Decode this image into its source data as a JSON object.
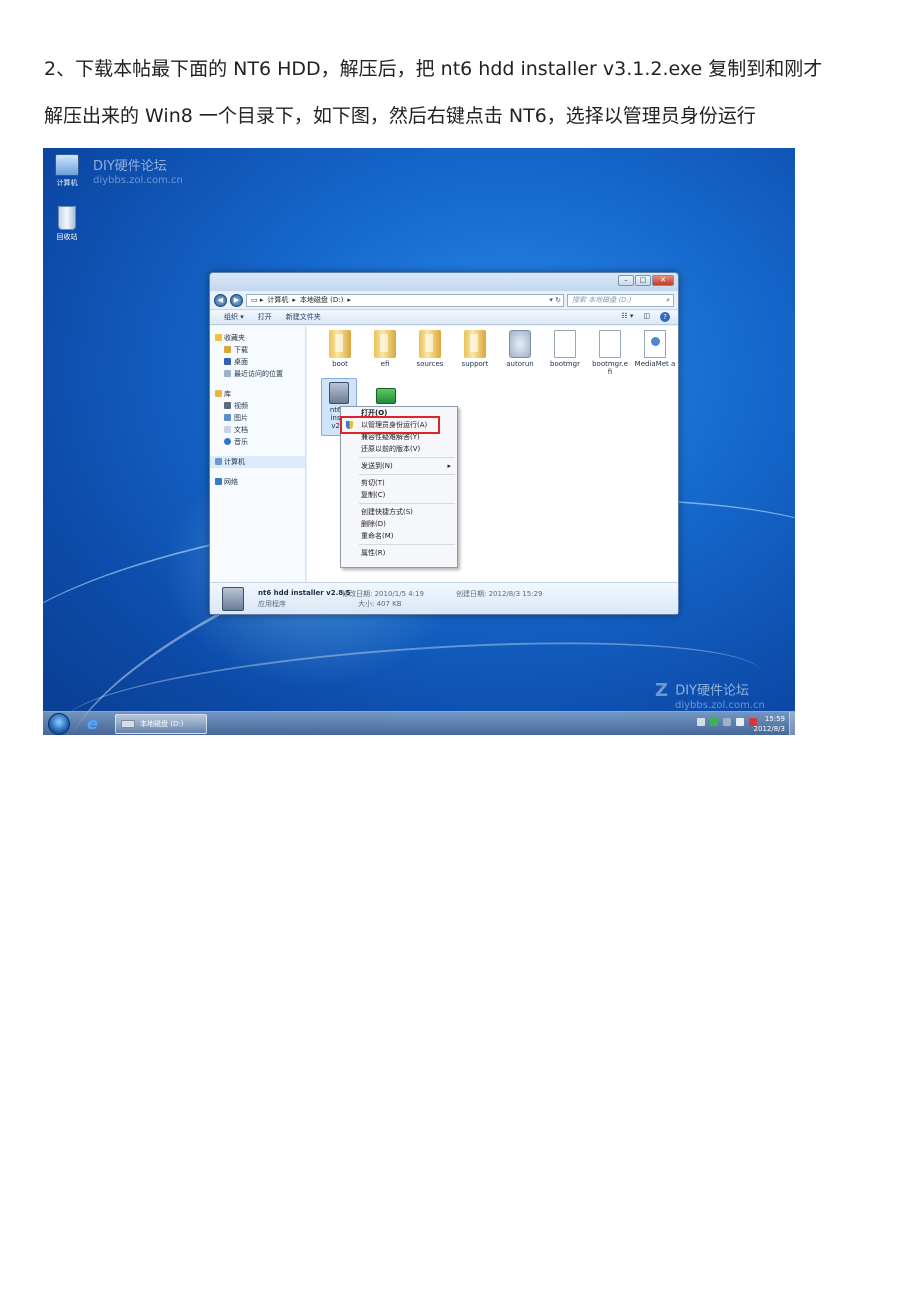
{
  "article": {
    "line1": "2、下载本帖最下面的 NT6 HDD，解压后，把 nt6 hdd installer v3.1.2.exe 复制到和刚才",
    "line2": "解压出来的 Win8 一个目录下，如下图，然后右键点击 NT6，选择以管理员身份运行"
  },
  "screenshot": {
    "desktop": {
      "icons": [
        "计算机",
        "回收站"
      ],
      "watermark_top": {
        "title": "DIY硬件论坛",
        "url": "diybbs.zol.com.cn"
      },
      "watermark_bottom": {
        "title": "DIY硬件论坛",
        "url": "diybbs.zol.com.cn"
      }
    },
    "explorer": {
      "breadcrumb": [
        "计算机",
        "本地磁盘 (D:)"
      ],
      "search_placeholder": "搜索 本地磁盘 (D:)",
      "toolbar": {
        "organize": "组织 ▾",
        "open": "打开",
        "new_folder": "新建文件夹"
      },
      "nav": {
        "favorites": "收藏夹",
        "downloads": "下载",
        "desktop": "桌面",
        "recent": "最近访问的位置",
        "libraries": "库",
        "videos": "视频",
        "pictures": "图片",
        "documents": "文档",
        "music": "音乐",
        "computer": "计算机",
        "network": "网络"
      },
      "files": [
        "boot",
        "efi",
        "sources",
        "support",
        "autorun",
        "bootmgr",
        "bootmgr.e fi",
        "MediaMet a"
      ],
      "selected_file_fragment": [
        "nt6 h",
        "insta",
        "v2.8"
      ],
      "context_menu": {
        "open": "打开(O)",
        "run_as_admin": "以管理员身份运行(A)",
        "troubleshoot": "兼容性疑难解答(Y)",
        "restore": "还原以前的版本(V)",
        "send_to": "发送到(N)",
        "cut": "剪切(T)",
        "copy": "复制(C)",
        "shortcut": "创建快捷方式(S)",
        "delete": "删除(D)",
        "rename": "重命名(M)",
        "properties": "属性(R)"
      },
      "details": {
        "name": "nt6 hdd installer v2.8.5",
        "kind": "应用程序",
        "modified": "修改日期: 2010/1/5 4:19",
        "size": "大小: 407 KB",
        "created": "创建日期: 2012/8/3 15:29"
      }
    },
    "taskbar": {
      "task_item": "本地磁盘 (D:)",
      "time": "15:59",
      "date": "2012/8/3"
    }
  }
}
